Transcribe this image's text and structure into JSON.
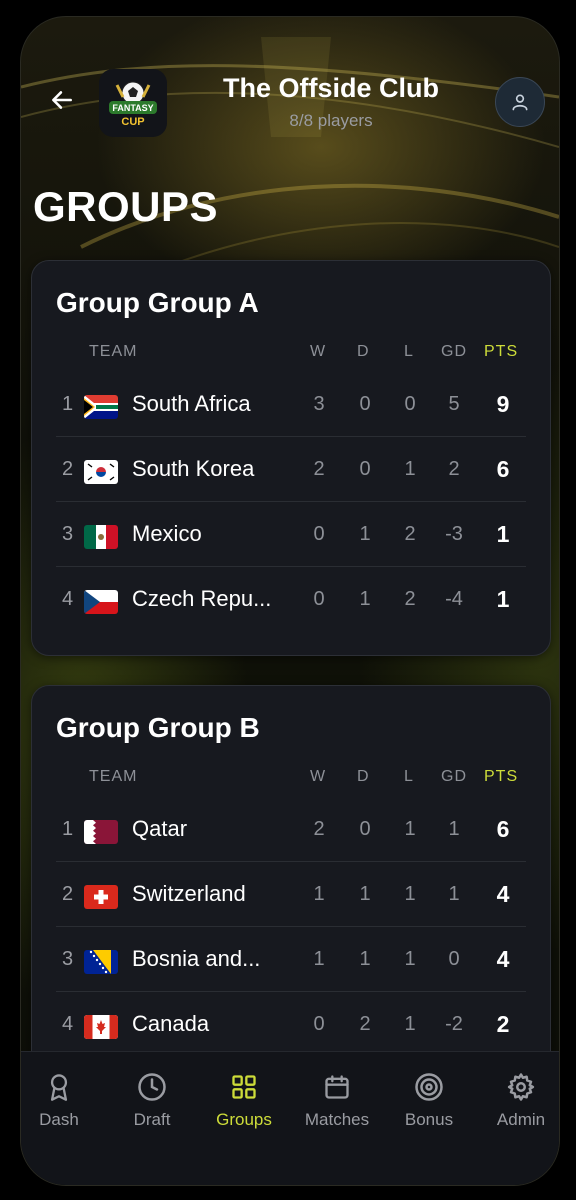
{
  "header": {
    "title": "The Offside Club",
    "subtitle": "8/8 players",
    "logo_text_top": "FANTASY",
    "logo_text_bottom": "CUP"
  },
  "page_title": "GROUPS",
  "columns": {
    "team": "TEAM",
    "w": "W",
    "d": "D",
    "l": "L",
    "gd": "GD",
    "pts": "PTS"
  },
  "groups": [
    {
      "title": "Group Group A",
      "rows": [
        {
          "rank": "1",
          "flag": "south-africa-flag",
          "team": "South Africa",
          "w": "3",
          "d": "0",
          "l": "0",
          "gd": "5",
          "pts": "9"
        },
        {
          "rank": "2",
          "flag": "south-korea-flag",
          "team": "South Korea",
          "w": "2",
          "d": "0",
          "l": "1",
          "gd": "2",
          "pts": "6"
        },
        {
          "rank": "3",
          "flag": "mexico-flag",
          "team": "Mexico",
          "w": "0",
          "d": "1",
          "l": "2",
          "gd": "-3",
          "pts": "1"
        },
        {
          "rank": "4",
          "flag": "czech-republic-flag",
          "team": "Czech Repu...",
          "w": "0",
          "d": "1",
          "l": "2",
          "gd": "-4",
          "pts": "1"
        }
      ]
    },
    {
      "title": "Group Group B",
      "rows": [
        {
          "rank": "1",
          "flag": "qatar-flag",
          "team": "Qatar",
          "w": "2",
          "d": "0",
          "l": "1",
          "gd": "1",
          "pts": "6"
        },
        {
          "rank": "2",
          "flag": "switzerland-flag",
          "team": "Switzerland",
          "w": "1",
          "d": "1",
          "l": "1",
          "gd": "1",
          "pts": "4"
        },
        {
          "rank": "3",
          "flag": "bosnia-flag",
          "team": "Bosnia and...",
          "w": "1",
          "d": "1",
          "l": "1",
          "gd": "0",
          "pts": "4"
        },
        {
          "rank": "4",
          "flag": "canada-flag",
          "team": "Canada",
          "w": "0",
          "d": "2",
          "l": "1",
          "gd": "-2",
          "pts": "2"
        }
      ]
    }
  ],
  "nav": {
    "items": [
      {
        "label": "Dash",
        "icon": "award-icon"
      },
      {
        "label": "Draft",
        "icon": "clock-icon"
      },
      {
        "label": "Groups",
        "icon": "grid-icon",
        "active": true
      },
      {
        "label": "Matches",
        "icon": "calendar-icon"
      },
      {
        "label": "Bonus",
        "icon": "target-icon"
      },
      {
        "label": "Admin",
        "icon": "gear-icon"
      }
    ]
  },
  "colors": {
    "accent": "#cddc39",
    "card": "#17191f",
    "background": "#0e0f08"
  }
}
